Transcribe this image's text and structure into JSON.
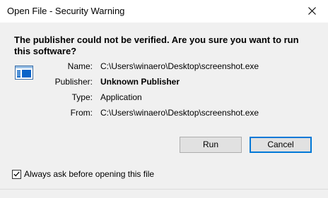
{
  "window": {
    "title": "Open File - Security Warning",
    "close_icon": "close-icon"
  },
  "message": {
    "headline": "The publisher could not be verified.  Are you sure you want to run this software?"
  },
  "file_icon": "application-window-icon",
  "details": {
    "name_label": "Name:",
    "name_value": "C:\\Users\\winaero\\Desktop\\screenshot.exe",
    "publisher_label": "Publisher:",
    "publisher_value": "Unknown Publisher",
    "type_label": "Type:",
    "type_value": "Application",
    "from_label": "From:",
    "from_value": "C:\\Users\\winaero\\Desktop\\screenshot.exe"
  },
  "buttons": {
    "run_label": "Run",
    "cancel_label": "Cancel"
  },
  "checkbox": {
    "label": "Always ask before opening this file",
    "checked": true
  },
  "colors": {
    "content_background": "#f0f0f0",
    "titlebar_background": "#ffffff",
    "default_button_border": "#0078d7",
    "icon_accent": "#0a64c8"
  }
}
